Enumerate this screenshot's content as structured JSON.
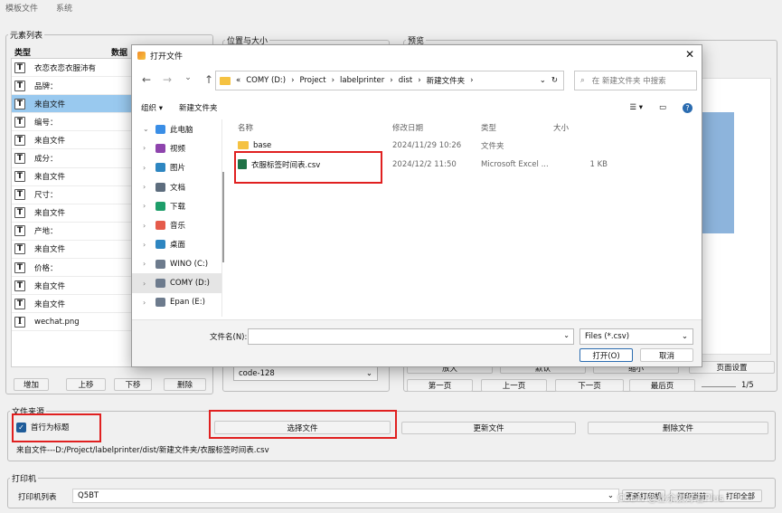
{
  "menu": [
    "模板文件",
    "系统"
  ],
  "element_panel": {
    "title": "元素列表",
    "col_type": "类型",
    "col_data": "数据",
    "rows": [
      {
        "type": "text",
        "value": "衣恋衣恋衣服沛有",
        "selected": false
      },
      {
        "type": "text",
        "value": "品牌：",
        "selected": false
      },
      {
        "type": "text",
        "value": "来自文件",
        "selected": true
      },
      {
        "type": "text",
        "value": "编号：",
        "selected": false
      },
      {
        "type": "text",
        "value": "来自文件",
        "selected": false
      },
      {
        "type": "text",
        "value": "成分：",
        "selected": false
      },
      {
        "type": "text",
        "value": "来自文件",
        "selected": false
      },
      {
        "type": "text",
        "value": "尺寸：",
        "selected": false
      },
      {
        "type": "text",
        "value": "来自文件",
        "selected": false
      },
      {
        "type": "text",
        "value": "产地：",
        "selected": false
      },
      {
        "type": "text",
        "value": "来自文件",
        "selected": false
      },
      {
        "type": "text",
        "value": "价格：",
        "selected": false
      },
      {
        "type": "text",
        "value": "来自文件",
        "selected": false
      },
      {
        "type": "text",
        "value": "来自文件",
        "selected": false
      },
      {
        "type": "image",
        "value": "wechat.png",
        "selected": false
      }
    ],
    "buttons": {
      "add": "增加",
      "up": "上移",
      "down": "下移",
      "delete": "删除"
    }
  },
  "position_panel": {
    "title": "位置与大小",
    "barcode_type": "code-128"
  },
  "preview_panel": {
    "title": "预览",
    "buttons_row1": [
      "放大",
      "默认",
      "缩小",
      "页面设置"
    ],
    "buttons_row2": [
      "第一页",
      "上一页",
      "下一页",
      "最后页"
    ],
    "page_indicator": "1/5"
  },
  "file_source": {
    "title": "文件来源",
    "first_row_header_label": "首行为标题",
    "first_row_header_checked": true,
    "select_file": "选择文件",
    "update_file": "更新文件",
    "delete_file": "删除文件",
    "current_file": "来自文件---D:/Project/labelprinter/dist/新建文件夹/衣服标签时间表.csv"
  },
  "printer": {
    "title": "打印机",
    "list_label": "打印机列表",
    "selected": "Q5BT",
    "refresh": "更新打印机",
    "print_current": "打印当前",
    "print_all": "打印全部"
  },
  "watermark": "CSDN @业余爱好者Plus",
  "dialog": {
    "title": "打开文件",
    "breadcrumb": [
      "«",
      "COMY (D:)",
      "Project",
      "labelprinter",
      "dist",
      "新建文件夹"
    ],
    "search_placeholder": "在 新建文件夹 中搜索",
    "organize": "组织 ▾",
    "new_folder": "新建文件夹",
    "tree": [
      {
        "label": "此电脑",
        "icon": "pc-icon",
        "color": "#3a8ee6",
        "expanded": true
      },
      {
        "label": "视频",
        "icon": "video-icon",
        "color": "#8e44ad"
      },
      {
        "label": "图片",
        "icon": "pictures-icon",
        "color": "#2e86c1"
      },
      {
        "label": "文档",
        "icon": "documents-icon",
        "color": "#5d6d7e"
      },
      {
        "label": "下载",
        "icon": "download-icon",
        "color": "#1e9e6a"
      },
      {
        "label": "音乐",
        "icon": "music-icon",
        "color": "#e55b4b"
      },
      {
        "label": "桌面",
        "icon": "desktop-icon",
        "color": "#2e86c1"
      },
      {
        "label": "WINO (C:)",
        "icon": "drive-icon",
        "color": "#6d7b8d"
      },
      {
        "label": "COMY (D:)",
        "icon": "drive-icon",
        "color": "#6d7b8d",
        "selected": true
      },
      {
        "label": "Epan (E:)",
        "icon": "drive-icon",
        "color": "#6d7b8d"
      }
    ],
    "columns": [
      "名称",
      "修改日期",
      "类型",
      "大小"
    ],
    "files": [
      {
        "name": "base",
        "date": "2024/11/29 10:26",
        "kind": "文件夹",
        "size": "",
        "icon": "folder-icon"
      },
      {
        "name": "衣服标签时间表.csv",
        "date": "2024/12/2 11:50",
        "kind": "Microsoft Excel ...",
        "size": "1 KB",
        "icon": "excel-icon"
      }
    ],
    "filename_label": "文件名(N):",
    "filename_value": "",
    "filetype": "Files (*.csv)",
    "open": "打开(O)",
    "cancel": "取消"
  }
}
